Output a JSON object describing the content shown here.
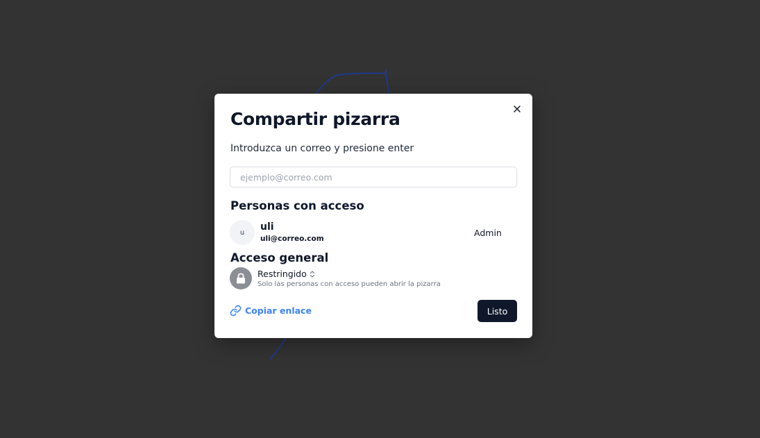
{
  "modal": {
    "title": "Compartir pizarra",
    "subtitle": "Introduzca un correo y presione enter",
    "email_placeholder": "ejemplo@correo.com",
    "close_icon": "close-icon"
  },
  "people": {
    "section_title": "Personas con acceso",
    "items": [
      {
        "avatar_initial": "u",
        "name": "uli",
        "email": "uli@correo.com",
        "role": "Admin"
      }
    ]
  },
  "general_access": {
    "section_title": "Acceso general",
    "icon": "lock-icon",
    "selected": "Restringido",
    "description": "Solo las personas con acceso pueden abrir la pizarra"
  },
  "footer": {
    "copy_link_label": "Copiar enlace",
    "copy_link_icon": "link-icon",
    "done_label": "Listo"
  },
  "colors": {
    "backdrop": "#333333",
    "primary_button": "#0f172a",
    "link": "#3b82f6",
    "stroke": "#1e3a8a"
  }
}
